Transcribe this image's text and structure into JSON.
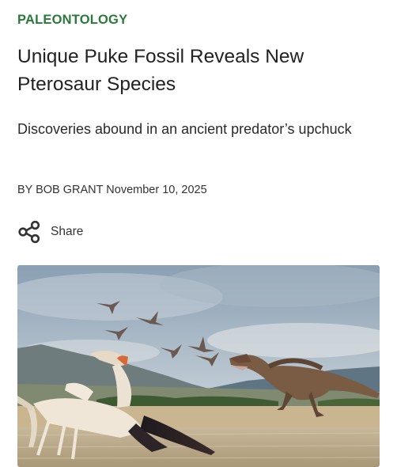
{
  "article": {
    "category": "PALEONTOLOGY",
    "headline": "Unique Puke Fossil Reveals New Pterosaur Species",
    "subheadline": "Discoveries abound in an ancient predator’s upchuck",
    "author": "BY BOB GRANT",
    "date": "November 10, 2025",
    "share_label": "Share",
    "share_icon": "share-icon"
  },
  "colors": {
    "category": "#2a7a3b",
    "text": "#222222"
  }
}
